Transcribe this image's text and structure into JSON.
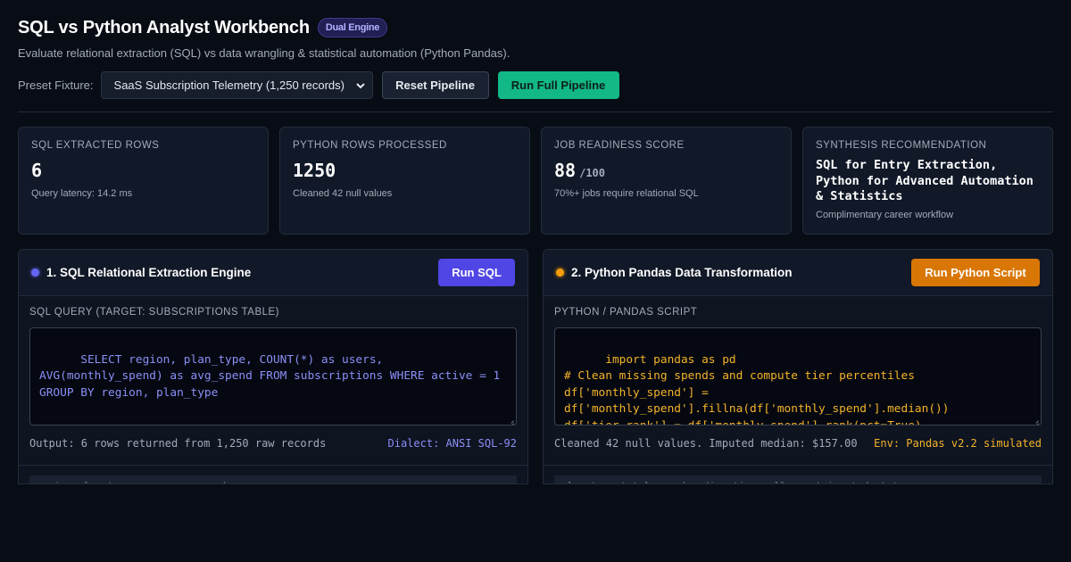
{
  "header": {
    "title": "SQL vs Python Analyst Workbench",
    "badge": "Dual Engine",
    "subtitle": "Evaluate relational extraction (SQL) vs data wrangling & statistical automation (Python Pandas)."
  },
  "controls": {
    "fixture_label": "Preset Fixture:",
    "fixture_selected": "SaaS Subscription Telemetry (1,250 records)",
    "reset_label": "Reset Pipeline",
    "run_label": "Run Full Pipeline"
  },
  "cards": [
    {
      "label": "SQL Extracted Rows",
      "value": "6",
      "note": "Query latency: 14.2 ms"
    },
    {
      "label": "Python Rows Processed",
      "value": "1250",
      "note": "Cleaned 42 null values"
    },
    {
      "label": "Job Readiness Score",
      "value": "88",
      "suffix": "/100",
      "note": "70%+ jobs require relational SQL"
    },
    {
      "label": "Synthesis Recommendation",
      "value": "SQL for Entry Extraction, Python for Advanced Automation & Statistics",
      "note": "Complimentary career workflow"
    }
  ],
  "sql_panel": {
    "title": "1. SQL Relational Extraction Engine",
    "run_label": "Run SQL",
    "field_label": "SQL Query (Target: subscriptions table)",
    "code": "SELECT region, plan_type, COUNT(*) as users, AVG(monthly_spend) as avg_spend FROM subscriptions WHERE active = 1 GROUP BY region, plan_type",
    "output": "Output: 6 rows returned from 1,250 raw records",
    "dialect": "Dialect: ANSI SQL-92",
    "table_peek": "region          plan_type                              users    avg_spend"
  },
  "python_panel": {
    "title": "2. Python Pandas Data Transformation",
    "run_label": "Run Python Script",
    "field_label": "Python / Pandas Script",
    "code": "import pandas as pd\n# Clean missing spends and compute tier percentiles\ndf['monthly_spend'] =\ndf['monthly_spend'].fillna(df['monthly_spend'].median())\ndf['tier_rank'] = df['monthly_spend'].rank(pct=True)\nsummary = df.groupby('plan_type')['tier_rank'].mean()",
    "output": "Cleaned 42 null values. Imputed median: $157.00",
    "env": "Env: Pandas v2.2 simulated",
    "table_peek": "plan_type    total_spend   median_tier   null_count   imputed   status"
  }
}
